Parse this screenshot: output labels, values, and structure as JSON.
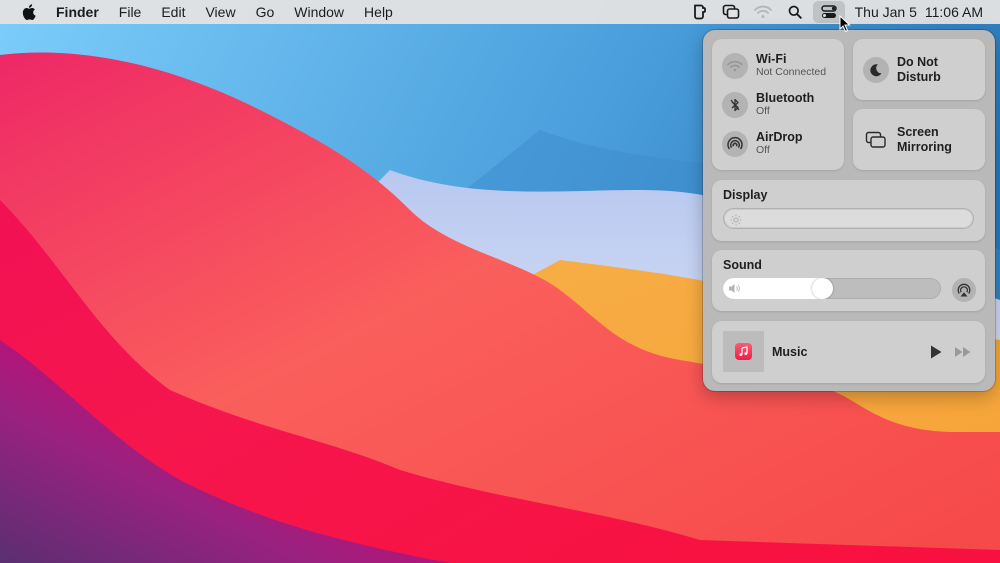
{
  "menubar": {
    "apple_icon": "apple-logo-icon",
    "app_name": "Finder",
    "menus": [
      "File",
      "Edit",
      "View",
      "Go",
      "Window",
      "Help"
    ],
    "status_icons": [
      "phone-icon",
      "screen-mirroring-icon",
      "wifi-icon",
      "search-icon",
      "control-center-icon"
    ],
    "clock": {
      "date": "Thu Jan 5",
      "time": "11:06 AM"
    }
  },
  "control_center": {
    "connectivity": [
      {
        "icon": "wifi-icon",
        "title": "Wi-Fi",
        "status": "Not Connected"
      },
      {
        "icon": "bluetooth-icon",
        "title": "Bluetooth",
        "status": "Off"
      },
      {
        "icon": "airdrop-icon",
        "title": "AirDrop",
        "status": "Off"
      }
    ],
    "do_not_disturb": {
      "icon": "moon-icon",
      "label_line1": "Do Not",
      "label_line2": "Disturb"
    },
    "screen_mirroring": {
      "icon": "screen-mirroring-icon",
      "label_line1": "Screen",
      "label_line2": "Mirroring"
    },
    "display": {
      "title": "Display",
      "brightness_percent": 0
    },
    "sound": {
      "title": "Sound",
      "volume_percent": 45
    },
    "now_playing": {
      "app": "Music",
      "icon": "music-app-icon"
    }
  },
  "colors": {
    "menubar_bg": "#e2e2e2",
    "panel_bg": "#b9b9b9",
    "tile_bg": "#cfcfcf",
    "music_icon": "#f5334f"
  }
}
